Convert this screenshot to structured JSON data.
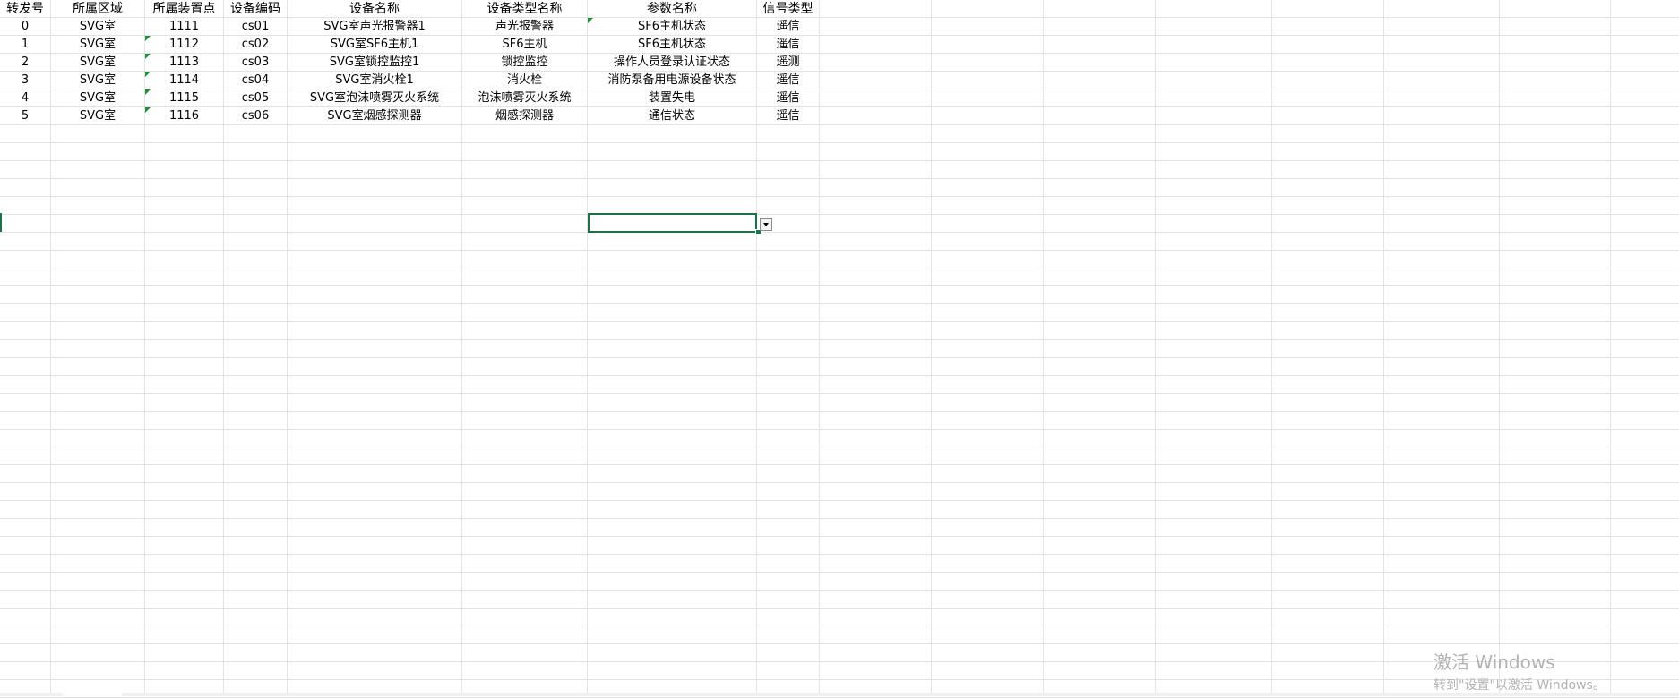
{
  "spreadsheet": {
    "columns": [
      "转发号",
      "所属区域",
      "所属装置点",
      "设备编码",
      "设备名称",
      "设备类型名称",
      "参数名称",
      "信号类型"
    ],
    "rows": [
      [
        "0",
        "SVG室",
        "1111",
        "cs01",
        "SVG室声光报警器1",
        "声光报警器",
        "SF6主机状态",
        "遥信"
      ],
      [
        "1",
        "SVG室",
        "1112",
        "cs02",
        "SVG室SF6主机1",
        "SF6主机",
        "SF6主机状态",
        "遥信"
      ],
      [
        "2",
        "SVG室",
        "1113",
        "cs03",
        "SVG室锁控监控1",
        "锁控监控",
        "操作人员登录认证状态",
        "遥测"
      ],
      [
        "3",
        "SVG室",
        "1114",
        "cs04",
        "SVG室消火栓1",
        "消火栓",
        "消防泵备用电源设备状态",
        "遥信"
      ],
      [
        "4",
        "SVG室",
        "1115",
        "cs05",
        "SVG室泡沫喷雾灭火系统",
        "泡沫喷雾灭火系统",
        "装置失电",
        "遥信"
      ],
      [
        "5",
        "SVG室",
        "1116",
        "cs06",
        "SVG室烟感探测器",
        "烟感探测器",
        "通信状态",
        "遥信"
      ]
    ],
    "active_cell": {
      "column": 6,
      "row": 12
    },
    "colors": {
      "gridline": "#e3e3e3",
      "selection": "#1e7145",
      "comment_marker": "#1e8e3e"
    }
  },
  "watermark": {
    "line1": "激活 Windows",
    "line2": "转到\"设置\"以激活 Windows。"
  }
}
